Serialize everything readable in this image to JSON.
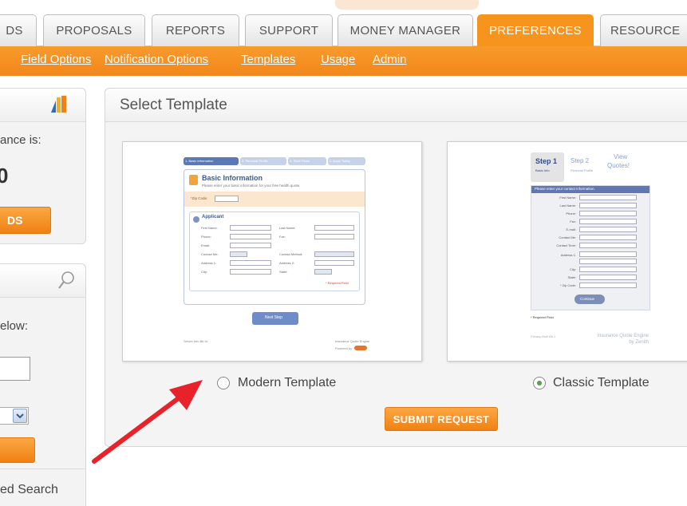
{
  "tabs": [
    {
      "label": "DS",
      "active": false
    },
    {
      "label": "PROPOSALS",
      "active": false
    },
    {
      "label": "REPORTS",
      "active": false
    },
    {
      "label": "SUPPORT",
      "active": false
    },
    {
      "label": "MONEY MANAGER",
      "active": false
    },
    {
      "label": "PREFERENCES",
      "active": true
    },
    {
      "label": "RESOURCE",
      "active": false
    }
  ],
  "subnav": [
    "Field Options",
    "Notification Options",
    "Templates",
    "Usage",
    "Admin"
  ],
  "sidebar": {
    "balance_text": "ance is:",
    "balance_value": "0",
    "orange_button": "DS",
    "below_text": "elow:",
    "adv_search": "ed Search"
  },
  "main": {
    "title": "Select Template",
    "submit_label": "SUBMIT REQUEST",
    "templates": [
      {
        "label": "Modern Template",
        "selected": false
      },
      {
        "label": "Classic Template",
        "selected": true
      }
    ]
  },
  "modern_preview": {
    "steps": [
      "1. Basic Information",
      "2. Personal Profile",
      "3. Save Plans",
      "4. Apply Today"
    ],
    "title": "Basic Information",
    "subtitle": "Please enter your basic information for your free health quote.",
    "zip_label": "*Zip Code:",
    "applicant": "Applicant",
    "left_fields": [
      "First Name:",
      "Phone:",
      "Email:",
      "Contact Me:",
      "Address 1:",
      "City:"
    ],
    "right_fields": [
      "Last Name:",
      "Fax:",
      "",
      "Contact Method:",
      "Address 2:",
      "State:"
    ],
    "required_note": "* Required Field",
    "next_button": "Next Step",
    "footer_left": "Server Info Bit Id",
    "footer_right_1": "Insurance Quote Engine",
    "footer_right_2": "Powered by"
  },
  "classic_preview": {
    "step1": "Step 1",
    "step1_sub": "Basic Info",
    "step2": "Step 2",
    "step2_sub": "Personal Profile",
    "step3a": "View",
    "step3b": "Quotes!",
    "banner": "Please enter your contact information.",
    "fields": [
      "First Name:",
      "Last Name:",
      "Phone:",
      "Fax:",
      "E-mail:",
      "Contact Me:",
      "Contact Time:",
      "Address 1:",
      "City:",
      "State:",
      "* Zip Code:"
    ],
    "continue": "Continue",
    "required": "* Required Field",
    "footer_left": "Privacy Built Bit 1",
    "footer_right": "Insurance Quote Engine by Zenith"
  },
  "colors": {
    "accent": "#f7941d",
    "arrow": "#e8222a",
    "radio_selected": "#5a9f4a"
  }
}
